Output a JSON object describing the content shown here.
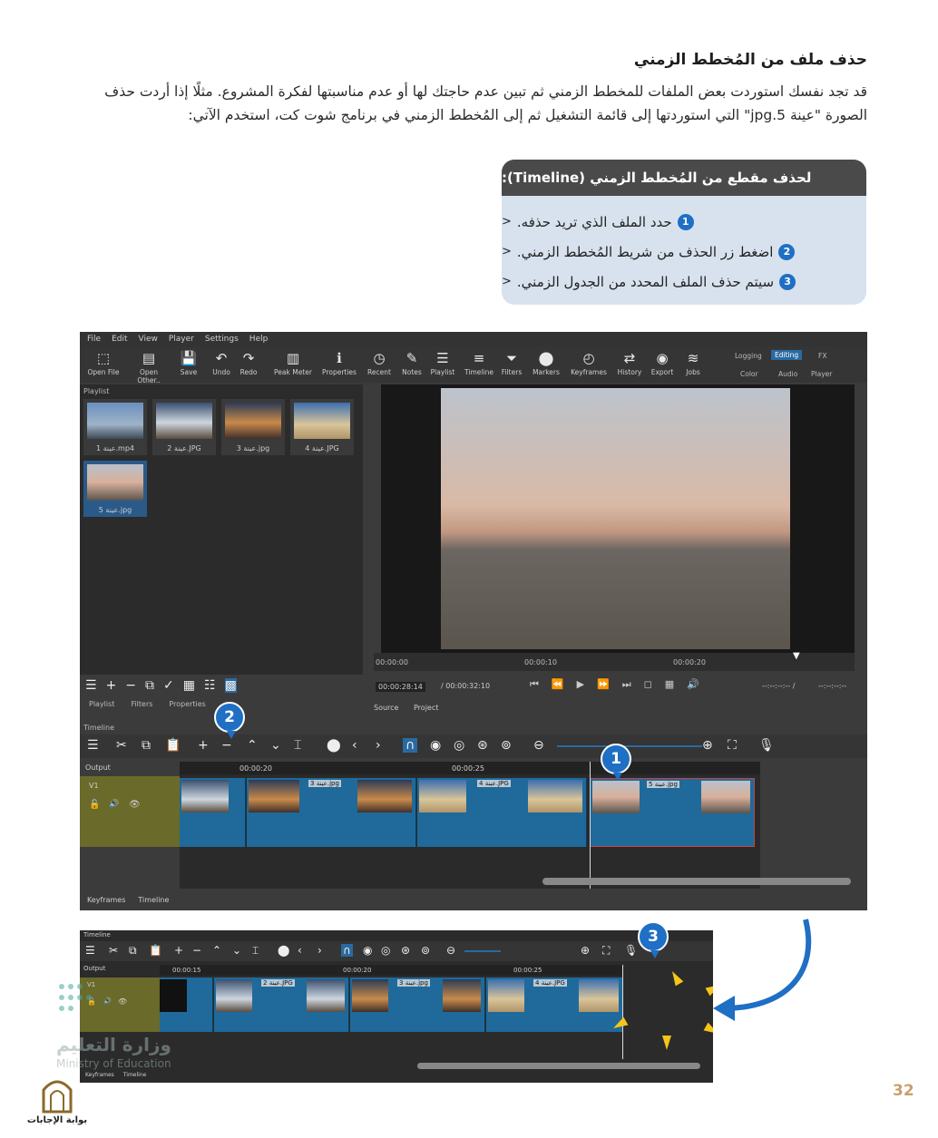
{
  "document": {
    "title": "حذف ملف من المُخطط الزمني",
    "paragraph": "قد تجد نفسك استوردت بعض الملفات للمخطط الزمني ثم تبين عدم حاجتك لها أو عدم مناسبتها لفكرة المشروع. مثلًا إذا أردت حذف الصورة \"عينة 5.jpg\" التي استوردتها إلى قائمة التشغيل ثم إلى المُخطط الزمني في برنامج شوت كت، استخدم الآتي:",
    "page_number": "32"
  },
  "steps_box": {
    "heading": "لحذف مقطع من المُخطط الزمني (Timeline):",
    "steps": [
      {
        "text": "حدد الملف الذي تريد حذفه.",
        "num": "1"
      },
      {
        "text": "اضغط زر الحذف من شريط المُخطط الزمني.",
        "num": "2"
      },
      {
        "text": "سيتم حذف الملف المحدد من الجدول الزمني.",
        "num": "3"
      }
    ]
  },
  "app": {
    "menu": [
      "File",
      "Edit",
      "View",
      "Player",
      "Settings",
      "Help"
    ],
    "toolbar": [
      {
        "label": "Open File",
        "icon": "⬚"
      },
      {
        "label": "Open Other..",
        "icon": "▤"
      },
      {
        "label": "Save",
        "icon": "💾"
      },
      {
        "label": "Undo",
        "icon": "↶"
      },
      {
        "label": "Redo",
        "icon": "↷"
      },
      {
        "label": "Peak Meter",
        "icon": "▥"
      },
      {
        "label": "Properties",
        "icon": "ℹ"
      },
      {
        "label": "Recent",
        "icon": "◷"
      },
      {
        "label": "Notes",
        "icon": "✎"
      },
      {
        "label": "Playlist",
        "icon": "☰"
      },
      {
        "label": "Timeline",
        "icon": "≡"
      },
      {
        "label": "Filters",
        "icon": "⏷"
      },
      {
        "label": "Markers",
        "icon": "⬤"
      },
      {
        "label": "Keyframes",
        "icon": "◴"
      },
      {
        "label": "History",
        "icon": "⇄"
      },
      {
        "label": "Export",
        "icon": "◉"
      },
      {
        "label": "Jobs",
        "icon": "≋"
      }
    ],
    "layout_modes": {
      "top": [
        "Logging",
        "Editing",
        "FX"
      ],
      "bottom": [
        "Color",
        "Audio",
        "Player"
      ]
    },
    "playlist_title": "Playlist",
    "playlist_items": [
      "1 عينة.mp4",
      "2 عينة.JPG",
      "3 عينة.jpg",
      "4 عينة.JPG",
      "5 عينة.jpg"
    ],
    "playlist_tabs": [
      "Playlist",
      "Filters",
      "Properties"
    ],
    "player_tabs": [
      "Source",
      "Project"
    ],
    "ruler_marks": [
      "00:00:00",
      "00:00:10",
      "00:00:20"
    ],
    "timecode": "00:00:28:14",
    "duration": "/ 00:00:32:10",
    "timecode_right": "--:--:--:-- /",
    "timecode_right2": "--:--:--:--",
    "timeline_title": "Timeline",
    "timeline_ruler": [
      "00:00:20",
      "00:00:25"
    ],
    "output_label": "Output",
    "track_label": "V1",
    "clip_labels": [
      "عينة 3.jpg",
      "عينة 4.JPG",
      "عينة 5.jpg"
    ],
    "bottom_tabs": [
      "Keyframes",
      "Timeline"
    ]
  },
  "app2": {
    "timeline_title": "Timeline",
    "ruler": [
      "00:00:15",
      "00:00:20",
      "00:00:25"
    ],
    "output_label": "Output",
    "track_label": "V1",
    "clip_labels": [
      "عينة 2.JPG",
      "عينة 3.jpg",
      "عينة 4.JPG"
    ],
    "bottom_tabs": [
      "Keyframes",
      "Timeline"
    ]
  },
  "callouts": [
    "1",
    "2",
    "3"
  ],
  "watermark": {
    "arabic": "وزارة التعليم",
    "english": "Ministry of Education"
  },
  "portal_label": "بوابة الإجابات"
}
